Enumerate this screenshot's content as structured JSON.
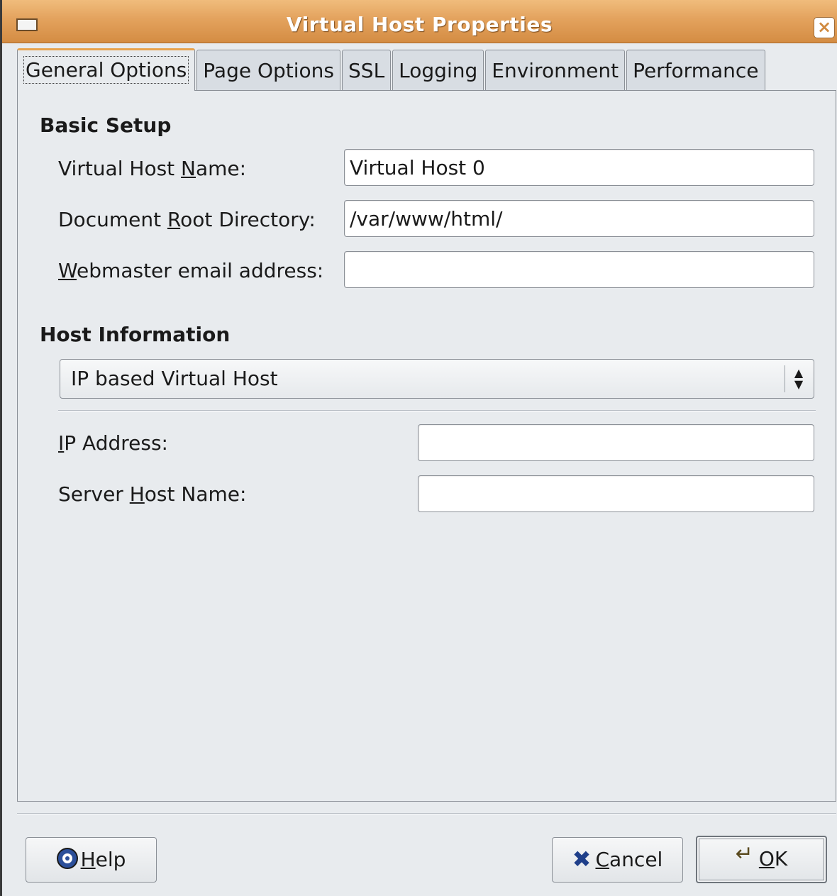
{
  "window": {
    "title": "Virtual Host Properties",
    "close_glyph": "×"
  },
  "tabs": [
    {
      "label": "General Options",
      "active": true
    },
    {
      "label": "Page Options",
      "active": false
    },
    {
      "label": "SSL",
      "active": false
    },
    {
      "label": "Logging",
      "active": false
    },
    {
      "label": "Environment",
      "active": false
    },
    {
      "label": "Performance",
      "active": false
    }
  ],
  "basic_setup": {
    "title": "Basic Setup",
    "virtual_host_name": {
      "label_pre": "Virtual Host ",
      "label_mn": "N",
      "label_post": "ame:",
      "value": "Virtual Host 0"
    },
    "document_root": {
      "label_pre": "Document ",
      "label_mn": "R",
      "label_post": "oot Directory:",
      "value": "/var/www/html/"
    },
    "webmaster_email": {
      "label_pre": "",
      "label_mn": "W",
      "label_post": "ebmaster email address:",
      "value": ""
    }
  },
  "host_information": {
    "title": "Host Information",
    "host_type": "IP based Virtual Host",
    "ip_address": {
      "label_pre": "",
      "label_mn": "I",
      "label_post": "P Address:",
      "value": ""
    },
    "server_host_name": {
      "label_pre": "Server ",
      "label_mn": "H",
      "label_post": "ost Name:",
      "value": ""
    }
  },
  "buttons": {
    "help": {
      "mn": "H",
      "rest": "elp"
    },
    "cancel": {
      "mn": "C",
      "rest": "ancel"
    },
    "ok": {
      "mn": "O",
      "rest": "K"
    }
  },
  "icons": {
    "help": "lifebuoy-icon",
    "cancel": "x-icon",
    "ok": "enter-arrow-icon"
  },
  "colors": {
    "titlebar": "#e3a25d",
    "active_tab_accent": "#e8a34e",
    "background": "#e8ebee"
  }
}
